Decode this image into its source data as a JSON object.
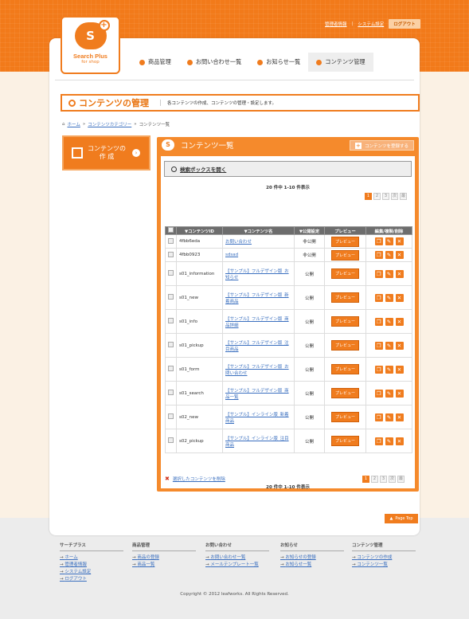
{
  "header": {
    "top_links": [
      "管理者情報",
      "システム設定"
    ],
    "logout": "ログアウト",
    "logo_line1": "Search Plus",
    "logo_line2": "for shop",
    "nav": [
      "商品管理",
      "お問い合わせ一覧",
      "お知らせ一覧",
      "コンテンツ管理"
    ]
  },
  "page_title": "コンテンツの管理",
  "page_desc": "各コンテンツの作成、コンテンツの管理・設定します。",
  "breadcrumb": [
    "ホーム",
    "コンテンツカテゴリー",
    "コンテンツ一覧"
  ],
  "side_button": {
    "line1": "コンテンツの",
    "line2": "作 成"
  },
  "panel": {
    "title": "コンテンツ一覧",
    "register": "コンテンツを登録する",
    "search": "検索ボックスを開く",
    "count": "20 件中 1-10 件表示",
    "pages": [
      "1",
      "2",
      "3",
      "次",
      "最"
    ],
    "delete_selected": "選択したコンテンツを削除"
  },
  "table": {
    "headers": [
      "",
      "▼コンテンツID",
      "▼コンテンツ名",
      "▼公開設定",
      "プレビュー",
      "編集/複製/削除"
    ],
    "preview_label": "プレビュー",
    "rows": [
      {
        "id": "4fbb6eda",
        "name": "お問い合わせ",
        "status": "非公開"
      },
      {
        "id": "4fbb0923",
        "name": "sdsad",
        "status": "非公開"
      },
      {
        "id": "s01_information",
        "name": "【サンプル】フルデザイン版_お知らせ",
        "status": "公開"
      },
      {
        "id": "s01_new",
        "name": "【サンプル】フルデザイン版_新着商品",
        "status": "公開"
      },
      {
        "id": "s01_info",
        "name": "【サンプル】フルデザイン版_商品詳細",
        "status": "公開"
      },
      {
        "id": "s01_pickup",
        "name": "【サンプル】フルデザイン版_注目商品",
        "status": "公開"
      },
      {
        "id": "s01_form",
        "name": "【サンプル】フルデザイン版_お問い合わせ",
        "status": "公開"
      },
      {
        "id": "s01_search",
        "name": "【サンプル】フルデザイン版_商品一覧",
        "status": "公開"
      },
      {
        "id": "s02_new",
        "name": "【サンプル】インライン版_新着商品",
        "status": "公開"
      },
      {
        "id": "s02_pickup",
        "name": "【サンプル】インライン版_注目商品",
        "status": "公開"
      }
    ]
  },
  "page_top": "Page Top",
  "footer": {
    "cols": [
      {
        "head": "サーチプラス",
        "links": [
          "ホーム",
          "管理者情報",
          "システム設定",
          "ログアウト"
        ]
      },
      {
        "head": "商品管理",
        "links": [
          "商品の登録",
          "商品一覧"
        ]
      },
      {
        "head": "お問い合わせ",
        "links": [
          "お問い合わせ一覧",
          "メールテンプレート一覧"
        ]
      },
      {
        "head": "お知らせ",
        "links": [
          "お知らせの登録",
          "お知らせ一覧"
        ]
      },
      {
        "head": "コンテンツ管理",
        "links": [
          "コンテンツの作成",
          "コンテンツ一覧"
        ]
      }
    ],
    "copyright": "Copyright © 2012 leafworks. All Rights Reserved."
  },
  "colors": {
    "accent": "#f07c1e",
    "link": "#3a6fbf"
  }
}
